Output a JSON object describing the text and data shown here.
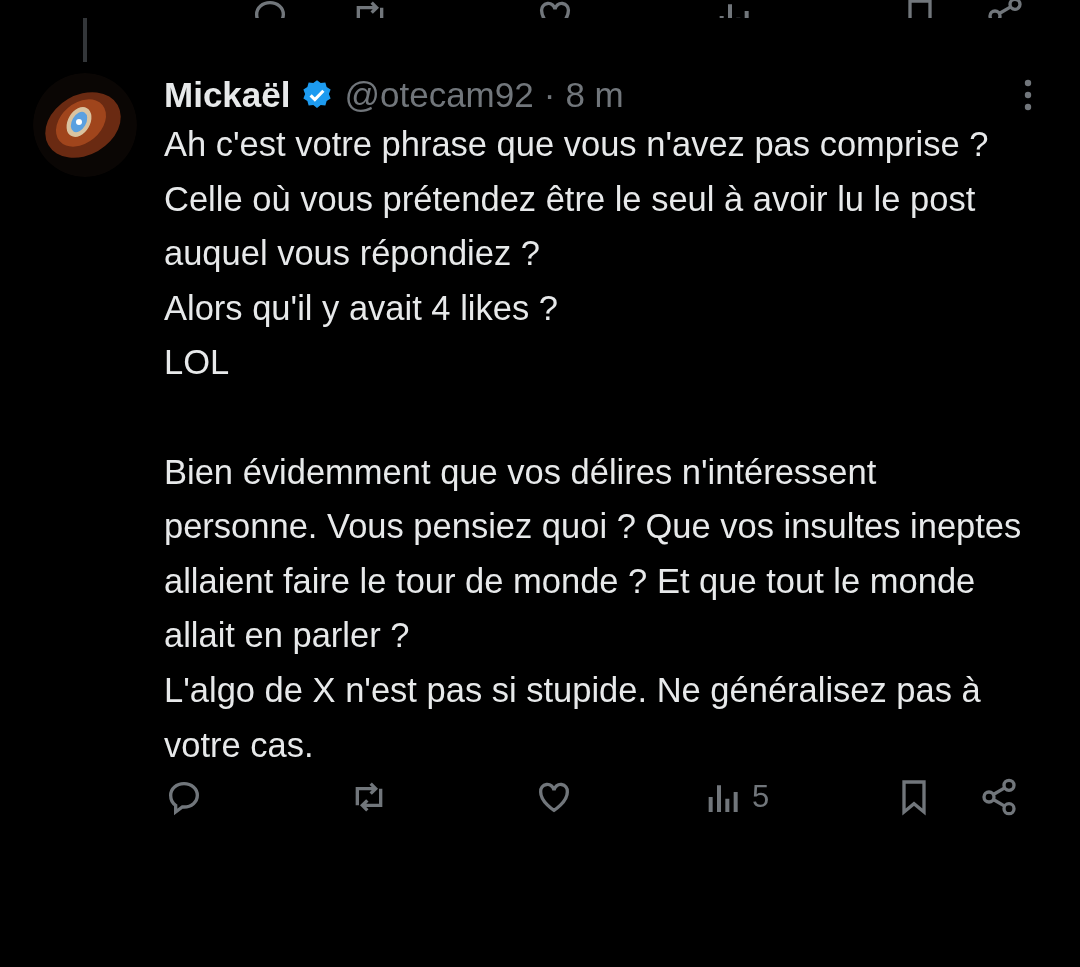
{
  "post": {
    "author": "Mickaël",
    "verified": true,
    "handle": "@otecam92",
    "separator": "·",
    "time": "8 m",
    "body": "Ah c'est votre phrase que vous n'avez pas comprise ?\nCelle où vous prétendez être le seul à avoir lu le post auquel vous répondiez ?\nAlors qu'il y avait 4 likes ?\nLOL\n\nBien évidemment que vos délires n'intéressent personne. Vous pensiez quoi ? Que vos insultes ineptes allaient faire le tour de monde ? Et que tout le monde allait en parler ?\nL'algo de X n'est pas si stupide. Ne généralisez pas à votre cas.",
    "views": "5"
  }
}
